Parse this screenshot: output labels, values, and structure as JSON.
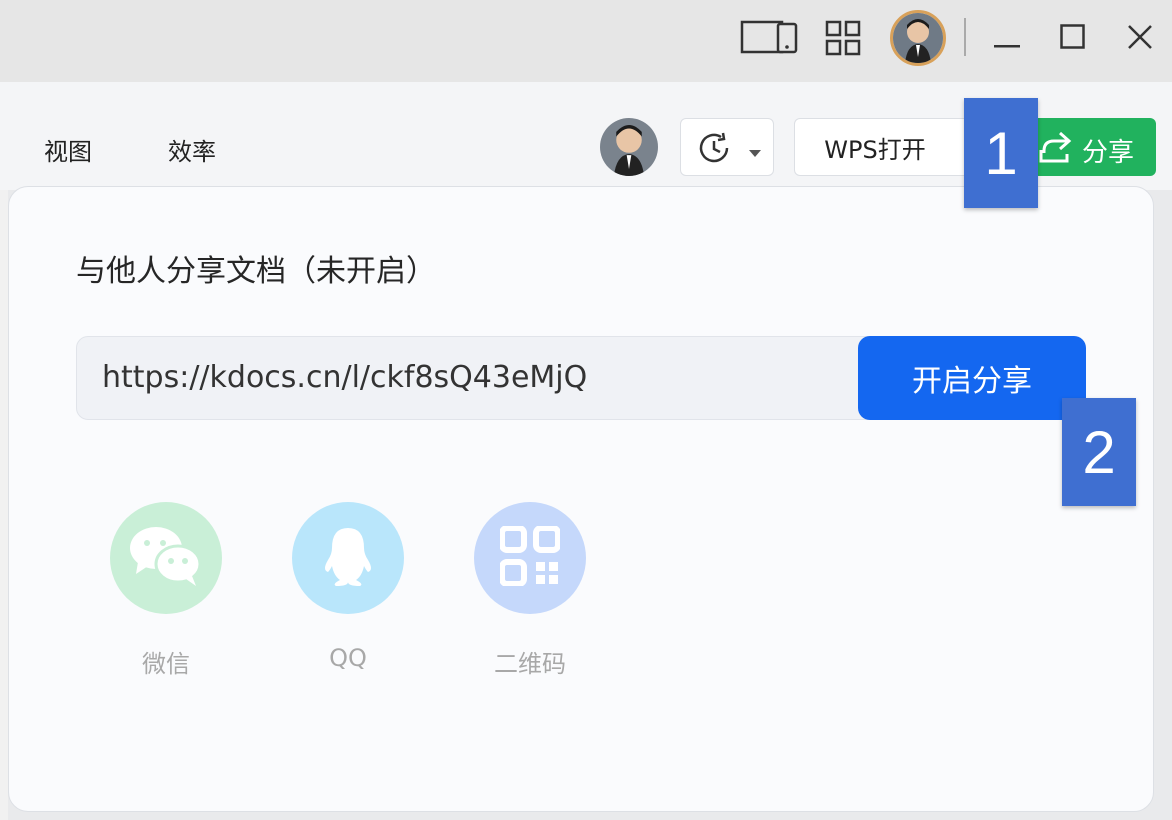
{
  "window_controls": {
    "minimize_icon": "minimize-icon",
    "maximize_icon": "maximize-icon",
    "close_icon": "close-icon"
  },
  "menu": {
    "view_label": "视图",
    "efficiency_label": "效率"
  },
  "toolbar": {
    "wps_open_label": "WPS打开",
    "share_label": "分享"
  },
  "share_popup": {
    "title": "与他人分享文档（未开启）",
    "url": "https://kdocs.cn/l/ckf8sQ43eMjQ",
    "enable_button_label": "开启分享",
    "channels": [
      {
        "label": "微信",
        "icon": "wechat-icon",
        "color": "#c9efd7"
      },
      {
        "label": "QQ",
        "icon": "qq-icon",
        "color": "#b9e6fb"
      },
      {
        "label": "二维码",
        "icon": "qrcode-icon",
        "color": "#c5d8fb"
      }
    ]
  },
  "annotations": {
    "badge1": "1",
    "badge2": "2"
  },
  "colors": {
    "share_green": "#21b25e",
    "enable_blue": "#1467f0",
    "badge_blue": "#3f6fd1"
  }
}
